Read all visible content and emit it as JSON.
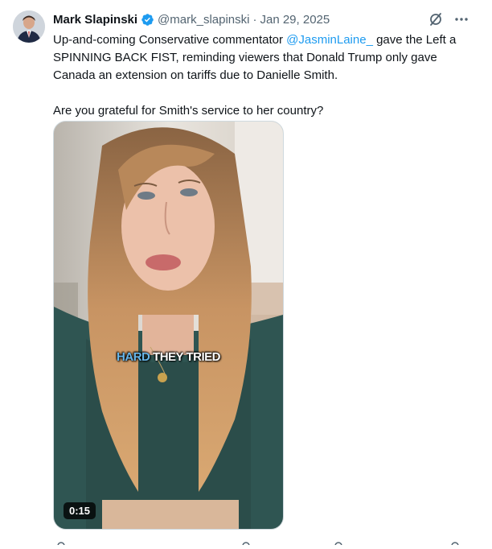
{
  "post": {
    "author_name": "Mark Slapinski",
    "handle": "@mark_slapinski",
    "separator": "·",
    "date": "Jan 29, 2025",
    "text_part1": "Up-and-coming Conservative commentator ",
    "mention": "@JasminLaine_",
    "text_part2": " gave the Left a SPINNING BACK FIST, reminding viewers that Donald Trump only gave Canada an extension on tariffs due to Danielle Smith.",
    "text_paragraph2": "Are you grateful for Smith's service to her country?"
  },
  "video": {
    "caption_highlight": "HARD",
    "caption_rest": " THEY TRIED",
    "duration": "0:15"
  },
  "icons": {
    "verified": "verified-badge-icon",
    "grok": "grok-icon",
    "more": "more-icon"
  },
  "colors": {
    "verified_blue": "#1d9bf0",
    "mention_blue": "#1d9bf0",
    "secondary_text": "#536471",
    "caption_blue": "#67b6ea"
  }
}
